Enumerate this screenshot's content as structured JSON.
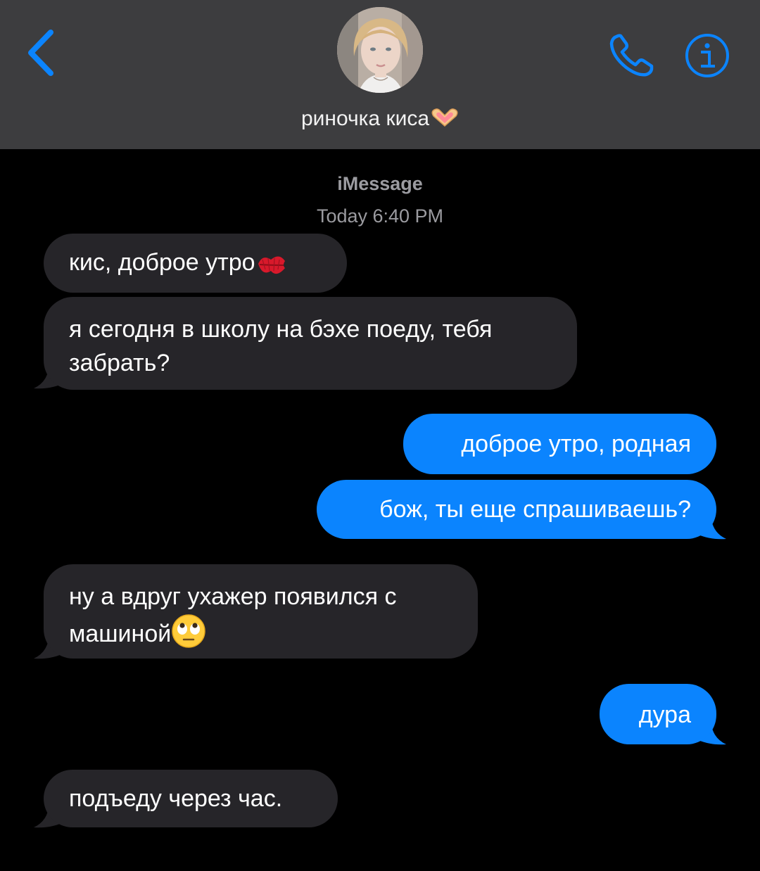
{
  "header": {
    "back_icon": "chevron-left-icon",
    "contact_name": "риночка киса",
    "contact_emoji": "heart-hands-emoji",
    "call_icon": "phone-icon",
    "info_icon": "info-icon",
    "accent_color": "#0b84fe"
  },
  "conversation": {
    "service": "iMessage",
    "timestamp": "Today 6:40 PM"
  },
  "messages": [
    {
      "direction": "incoming",
      "text": "кис, доброе утро",
      "emoji": "kiss-mark-emoji"
    },
    {
      "direction": "incoming",
      "text": "я сегодня в школу на бэхе поеду, тебя забрать?"
    },
    {
      "direction": "outgoing",
      "text": "доброе утро, родная"
    },
    {
      "direction": "outgoing",
      "text": "бож, ты еще спрашиваешь?"
    },
    {
      "direction": "incoming",
      "text": " ну а вдруг ухажер появился с машиной",
      "emoji": "eye-roll-emoji"
    },
    {
      "direction": "outgoing",
      "text": "дура"
    },
    {
      "direction": "incoming",
      "text": "подъеду через час."
    }
  ],
  "colors": {
    "incoming_bubble": "#262529",
    "outgoing_bubble": "#0b84fe",
    "header_bg": "#3d3d3f",
    "background": "#000000"
  }
}
